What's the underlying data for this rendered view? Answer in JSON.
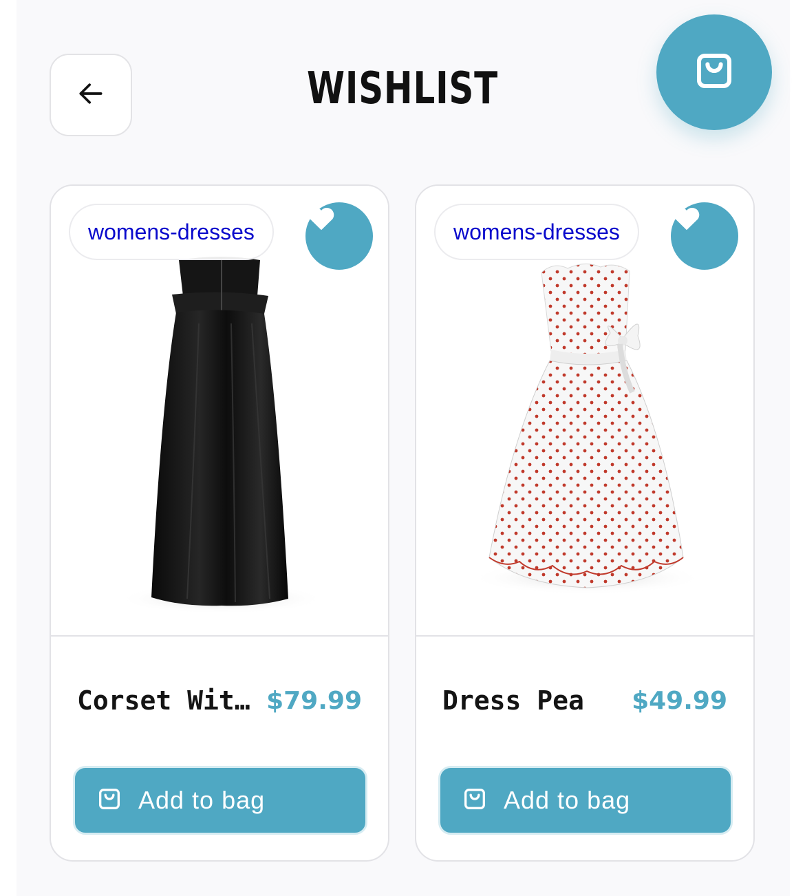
{
  "header": {
    "title": "WISHLIST",
    "back_icon": "arrow-left-icon",
    "cart_icon": "shopping-bag-icon"
  },
  "colors": {
    "accent": "#4fa8c3",
    "category_text": "#0a0acc",
    "background": "#f9f9fb"
  },
  "products": [
    {
      "category": "womens-dresses",
      "name": "Corset Wit...",
      "price": "$79.99",
      "button_label": "Add to bag",
      "favorite_icon": "heart-icon",
      "image": "black corset maxi dress"
    },
    {
      "category": "womens-dresses",
      "name": "Dress Pea",
      "price": "$49.99",
      "button_label": "Add to bag",
      "favorite_icon": "heart-icon",
      "image": "white polka dot strapless dress"
    }
  ]
}
